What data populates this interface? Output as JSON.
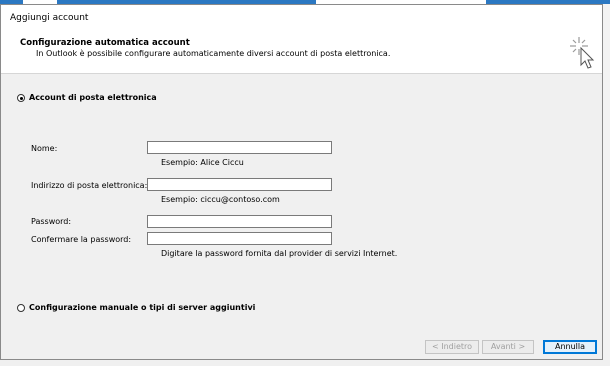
{
  "window": {
    "title": "Aggiungi account"
  },
  "header": {
    "title": "Configurazione automatica account",
    "subtitle": "In Outlook è possibile configurare automaticamente diversi account di posta elettronica.",
    "icon": "magic-wand-cursor-icon"
  },
  "options": {
    "email_account": {
      "label": "Account di posta elettronica",
      "selected": true
    },
    "manual_setup": {
      "label": "Configurazione manuale o tipi di server aggiuntivi",
      "selected": false
    }
  },
  "form": {
    "name": {
      "label": "Nome:",
      "value": "",
      "hint": "Esempio: Alice Ciccu"
    },
    "email": {
      "label": "Indirizzo di posta elettronica:",
      "value": "",
      "hint": "Esempio: ciccu@contoso.com"
    },
    "password": {
      "label": "Password:",
      "value": ""
    },
    "confirm_password": {
      "label": "Confermare la password:",
      "value": "",
      "hint": "Digitare la password fornita dal provider di servizi Internet."
    }
  },
  "buttons": {
    "back": "< Indietro",
    "next": "Avanti >",
    "cancel": "Annulla"
  },
  "colors": {
    "accent": "#0078d7",
    "dialog_bg": "#f0f0f0",
    "taskbar_accent": "#2b78c2"
  }
}
